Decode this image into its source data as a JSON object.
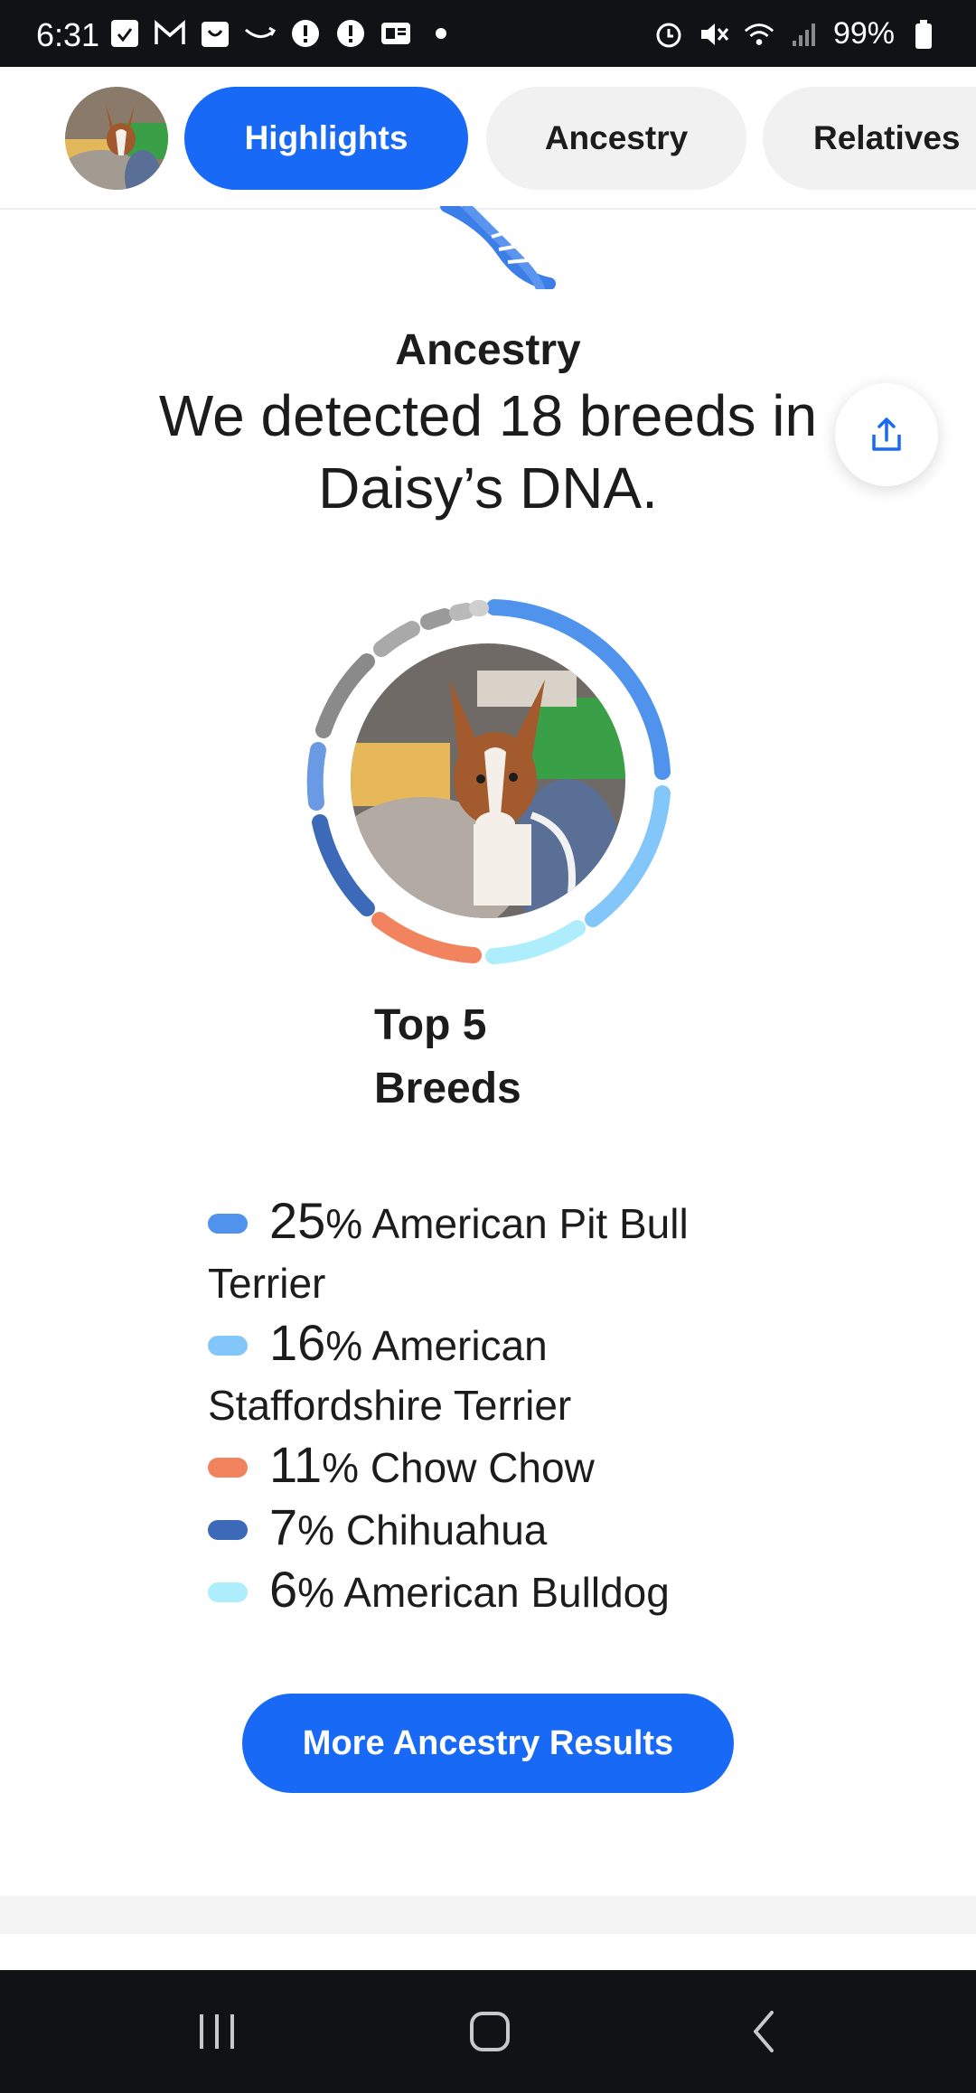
{
  "status_bar": {
    "time": "6:31",
    "battery": "99%",
    "left_icons": [
      "call-filter-icon",
      "gmail-icon",
      "shopping-bag-icon",
      "amazon-icon",
      "alert-icon",
      "alert-icon",
      "news-icon",
      "dot-icon"
    ],
    "right_icons": [
      "alarm-icon",
      "mute-icon",
      "wifi-icon",
      "signal-icon",
      "battery-icon"
    ]
  },
  "nav": {
    "tabs": [
      {
        "label": "Highlights",
        "active": true
      },
      {
        "label": "Ancestry",
        "active": false
      },
      {
        "label": "Relatives",
        "active": false
      }
    ]
  },
  "ancestry": {
    "section_title": "Ancestry",
    "headline": "We detected 18 breeds in Daisy’s DNA.",
    "top5_label_line1": "Top 5",
    "top5_label_line2": "Breeds",
    "cta_label": "More Ancestry Results"
  },
  "breeds": [
    {
      "pct": "25",
      "name": "% American Pit Bull Terrier",
      "color": "#4f93ec"
    },
    {
      "pct": "16",
      "name": "% American Staffordshire Terrier",
      "color": "#83c7fa"
    },
    {
      "pct": "11",
      "name": "% Chow Chow",
      "color": "#f1845f"
    },
    {
      "pct": "7",
      "name": "% Chihuahua",
      "color": "#3c69b8"
    },
    {
      "pct": "6",
      "name": "% American Bulldog",
      "color": "#aeeefc"
    }
  ],
  "colors": {
    "accent": "#1869f5",
    "pill_inactive": "#f1f1f1"
  },
  "nav_bar": {
    "buttons": [
      "recents-icon",
      "home-icon",
      "back-icon"
    ]
  }
}
